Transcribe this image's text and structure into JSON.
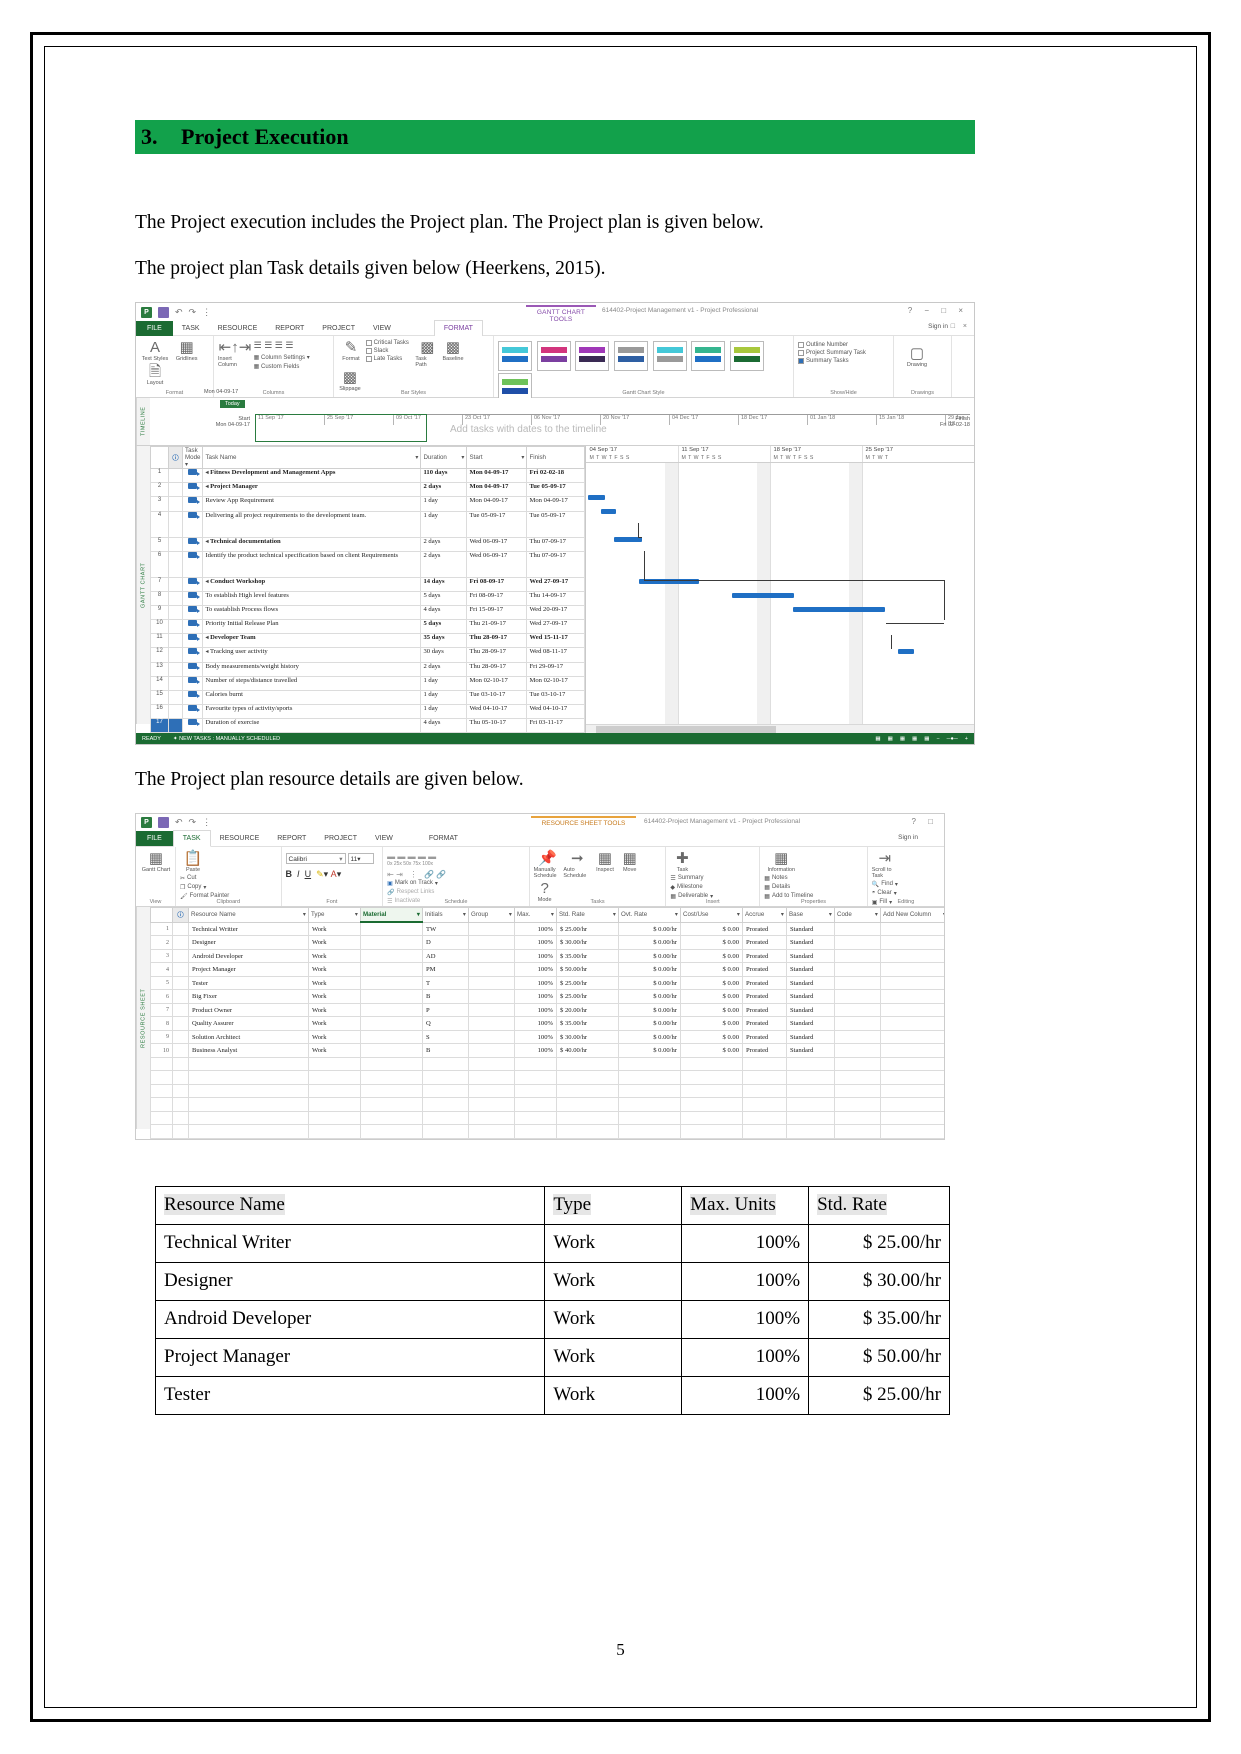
{
  "document": {
    "heading_number": "3.",
    "heading_title": "Project Execution",
    "paragraph_1": "The Project execution includes the Project plan. The Project plan is given below.",
    "paragraph_2": "The project plan Task details given below (Heerkens, 2015).",
    "paragraph_3": "The Project plan resource details are given below.",
    "page_number": "5",
    "heading_band_color": "#12A14B"
  },
  "gantt_screenshot": {
    "title_bar": {
      "app_icon": "project-icon",
      "context_tab": "GANTT CHART TOOLS",
      "document_title": "614402-Project Management v1 - Project Professional",
      "sign_in": "Sign in",
      "help": "?"
    },
    "ribbon_tabs": [
      "FILE",
      "TASK",
      "RESOURCE",
      "REPORT",
      "PROJECT",
      "VIEW",
      "FORMAT"
    ],
    "active_tab": "FORMAT",
    "ribbon_groups": [
      {
        "label": "Format",
        "buttons": [
          "Text Styles",
          "Gridlines",
          "Layout"
        ]
      },
      {
        "label": "Columns",
        "buttons": [
          "Insert Column",
          "Column Settings",
          "Custom Fields"
        ]
      },
      {
        "label": "Bar Styles",
        "checkboxes": [
          "Critical Tasks",
          "Slack",
          "Late Tasks"
        ],
        "buttons": [
          "Format",
          "Task Path",
          "Baseline",
          "Slippage"
        ]
      },
      {
        "label": "Gantt Chart Style"
      },
      {
        "label": "Show/Hide",
        "checkboxes": [
          "Outline Number",
          "Project Summary Task",
          "Summary Tasks"
        ]
      },
      {
        "label": "Drawings",
        "buttons": [
          "Drawing"
        ]
      }
    ],
    "timeline": {
      "side_label": "TIMELINE",
      "today_label": "Today",
      "today_date": "Mon 04-09-17",
      "start_label": "Start",
      "start_date": "Mon 04-09-17",
      "finish_label": "Finish",
      "finish_date": "Fri 02-02-18",
      "placeholder": "Add tasks with dates to the timeline",
      "ticks": [
        "11 Sep '17",
        "25 Sep '17",
        "09 Oct '17",
        "23 Oct '17",
        "06 Nov '17",
        "20 Nov '17",
        "04 Dec '17",
        "18 Dec '17",
        "01 Jan '18",
        "15 Jan '18",
        "29 Jan '18"
      ]
    },
    "side_label": "GANTT CHART",
    "columns": [
      "",
      "i",
      "Task Mode",
      "Task Name",
      "Duration",
      "Start",
      "Finish"
    ],
    "rows": [
      {
        "id": "1",
        "level": 0,
        "name": "Fitness Development and Management Apps",
        "duration": "110 days",
        "start": "Mon 04-09-17",
        "finish": "Fri 02-02-18",
        "bold": true
      },
      {
        "id": "2",
        "level": 1,
        "name": "Project Manager",
        "duration": "2 days",
        "start": "Mon 04-09-17",
        "finish": "Tue 05-09-17",
        "bold": true
      },
      {
        "id": "3",
        "level": 2,
        "name": "Review App Requirement",
        "duration": "1 day",
        "start": "Mon 04-09-17",
        "finish": "Mon 04-09-17",
        "bold": false
      },
      {
        "id": "4",
        "level": 2,
        "name": "Delivering all project requirements to the development team.",
        "duration": "1 day",
        "start": "Tue 05-09-17",
        "finish": "Tue 05-09-17",
        "bold": false
      },
      {
        "id": "5",
        "level": 1,
        "name": "Technical documentation",
        "duration": "2 days",
        "start": "Wed 06-09-17",
        "finish": "Thu 07-09-17",
        "bold": true
      },
      {
        "id": "6",
        "level": 2,
        "name": "Identify the product technical specification based on client Requirements",
        "duration": "2 days",
        "start": "Wed 06-09-17",
        "finish": "Thu 07-09-17",
        "bold": false
      },
      {
        "id": "7",
        "level": 1,
        "name": "Conduct Workshop",
        "duration": "14 days",
        "start": "Fri 08-09-17",
        "finish": "Wed 27-09-17",
        "bold": true
      },
      {
        "id": "8",
        "level": 2,
        "name": "To establish High level features",
        "duration": "5 days",
        "start": "Fri 08-09-17",
        "finish": "Thu 14-09-17",
        "bold": false
      },
      {
        "id": "9",
        "level": 2,
        "name": "To eastablish Process flows",
        "duration": "4 days",
        "start": "Fri 15-09-17",
        "finish": "Wed 20-09-17",
        "bold": false
      },
      {
        "id": "10",
        "level": 2,
        "name": "Priority Initial Release Plan",
        "duration": "5 days",
        "start": "Thu 21-09-17",
        "finish": "Wed 27-09-17",
        "bold": false
      },
      {
        "id": "11",
        "level": 1,
        "name": "Developer Team",
        "duration": "35 days",
        "start": "Thu 28-09-17",
        "finish": "Wed 15-11-17",
        "bold": true
      },
      {
        "id": "12",
        "level": 2,
        "name": "Tracking user activity",
        "duration": "30 days",
        "start": "Thu 28-09-17",
        "finish": "Wed 08-11-17",
        "bold": false
      },
      {
        "id": "13",
        "level": 3,
        "name": "Body measurements/weight history",
        "duration": "2 days",
        "start": "Thu 28-09-17",
        "finish": "Fri 29-09-17",
        "bold": false
      },
      {
        "id": "14",
        "level": 3,
        "name": "Number of steps/distance travelled",
        "duration": "1 day",
        "start": "Mon 02-10-17",
        "finish": "Mon 02-10-17",
        "bold": false
      },
      {
        "id": "15",
        "level": 3,
        "name": "Calories burnt",
        "duration": "1 day",
        "start": "Tue 03-10-17",
        "finish": "Tue 03-10-17",
        "bold": false
      },
      {
        "id": "16",
        "level": 3,
        "name": "Favourite types of activity/sports",
        "duration": "1 day",
        "start": "Wed 04-10-17",
        "finish": "Wed 04-10-17",
        "bold": false
      },
      {
        "id": "17",
        "level": 3,
        "name": "Duration of exercise",
        "duration": "4 days",
        "start": "Thu 05-10-17",
        "finish": "Fri 03-11-17",
        "bold": false
      }
    ],
    "chart_header": [
      {
        "label": "04 Sep '17",
        "days": "M T W T F S S"
      },
      {
        "label": "11 Sep '17",
        "days": "M T W T F S S"
      },
      {
        "label": "18 Sep '17",
        "days": "M T W T F S S"
      },
      {
        "label": "25 Sep '17",
        "days": "M T W T"
      }
    ],
    "status_bar": {
      "ready": "READY",
      "new_tasks": "NEW TASKS : MANUALLY SCHEDULED",
      "zoom": "100%"
    }
  },
  "resource_screenshot": {
    "title_bar": {
      "context_tab": "RESOURCE SHEET TOOLS",
      "document_title": "614402-Project Management v1 - Project Professional",
      "sign_in": "Sign in"
    },
    "ribbon_tabs": [
      "FILE",
      "TASK",
      "RESOURCE",
      "REPORT",
      "PROJECT",
      "VIEW",
      "FORMAT"
    ],
    "active_tab": "TASK",
    "ribbon_groups": [
      {
        "label": "View",
        "buttons": [
          "Gantt Chart"
        ]
      },
      {
        "label": "Clipboard",
        "buttons": [
          "Paste",
          "Cut",
          "Copy",
          "Format Painter"
        ]
      },
      {
        "label": "Font",
        "font_name": "Calibri",
        "font_size": "11",
        "buttons": [
          "B",
          "I",
          "U"
        ]
      },
      {
        "label": "Schedule",
        "buttons": [
          "Mark on Track",
          "Respect Links",
          "Inactivate"
        ],
        "percents": [
          "0x",
          "25x",
          "50x",
          "75x",
          "100x"
        ]
      },
      {
        "label": "Tasks",
        "buttons": [
          "Manually Schedule",
          "Auto Schedule",
          "Inspect",
          "Move",
          "Mode"
        ]
      },
      {
        "label": "Insert",
        "buttons": [
          "Task",
          "Summary",
          "Milestone",
          "Deliverable"
        ]
      },
      {
        "label": "Properties",
        "buttons": [
          "Information",
          "Notes",
          "Details",
          "Add to Timeline"
        ]
      },
      {
        "label": "Editing",
        "buttons": [
          "Scroll to Task",
          "Find",
          "Clear",
          "Fill"
        ]
      }
    ],
    "side_label": "RESOURCE SHEET",
    "columns": [
      "",
      "i",
      "Resource Name",
      "Type",
      "Material",
      "Initials",
      "Group",
      "Max.",
      "Std. Rate",
      "Ovt. Rate",
      "Cost/Use",
      "Accrue",
      "Base",
      "Code",
      "Add New Column"
    ],
    "selected_column": "Material",
    "rows": [
      {
        "id": "1",
        "name": "Technical Writter",
        "type": "Work",
        "material": "",
        "initials": "TW",
        "group": "",
        "max": "100%",
        "std_rate": "$ 25.00/hr",
        "ovt_rate": "$ 0.00/hr",
        "cost_use": "$ 0.00",
        "accrue": "Prorated",
        "base": "Standard"
      },
      {
        "id": "2",
        "name": "Designer",
        "type": "Work",
        "material": "",
        "initials": "D",
        "group": "",
        "max": "100%",
        "std_rate": "$ 30.00/hr",
        "ovt_rate": "$ 0.00/hr",
        "cost_use": "$ 0.00",
        "accrue": "Prorated",
        "base": "Standard"
      },
      {
        "id": "3",
        "name": "Android Developer",
        "type": "Work",
        "material": "",
        "initials": "AD",
        "group": "",
        "max": "100%",
        "std_rate": "$ 35.00/hr",
        "ovt_rate": "$ 0.00/hr",
        "cost_use": "$ 0.00",
        "accrue": "Prorated",
        "base": "Standard"
      },
      {
        "id": "4",
        "name": "Project Manager",
        "type": "Work",
        "material": "",
        "initials": "PM",
        "group": "",
        "max": "100%",
        "std_rate": "$ 50.00/hr",
        "ovt_rate": "$ 0.00/hr",
        "cost_use": "$ 0.00",
        "accrue": "Prorated",
        "base": "Standard"
      },
      {
        "id": "5",
        "name": "Tester",
        "type": "Work",
        "material": "",
        "initials": "T",
        "group": "",
        "max": "100%",
        "std_rate": "$ 25.00/hr",
        "ovt_rate": "$ 0.00/hr",
        "cost_use": "$ 0.00",
        "accrue": "Prorated",
        "base": "Standard"
      },
      {
        "id": "6",
        "name": "Big Fixer",
        "type": "Work",
        "material": "",
        "initials": "B",
        "group": "",
        "max": "100%",
        "std_rate": "$ 25.00/hr",
        "ovt_rate": "$ 0.00/hr",
        "cost_use": "$ 0.00",
        "accrue": "Prorated",
        "base": "Standard"
      },
      {
        "id": "7",
        "name": "Product Owner",
        "type": "Work",
        "material": "",
        "initials": "P",
        "group": "",
        "max": "100%",
        "std_rate": "$ 20.00/hr",
        "ovt_rate": "$ 0.00/hr",
        "cost_use": "$ 0.00",
        "accrue": "Prorated",
        "base": "Standard"
      },
      {
        "id": "8",
        "name": "Quality Assurer",
        "type": "Work",
        "material": "",
        "initials": "Q",
        "group": "",
        "max": "100%",
        "std_rate": "$ 35.00/hr",
        "ovt_rate": "$ 0.00/hr",
        "cost_use": "$ 0.00",
        "accrue": "Prorated",
        "base": "Standard"
      },
      {
        "id": "9",
        "name": "Solution Architect",
        "type": "Work",
        "material": "",
        "initials": "S",
        "group": "",
        "max": "100%",
        "std_rate": "$ 30.00/hr",
        "ovt_rate": "$ 0.00/hr",
        "cost_use": "$ 0.00",
        "accrue": "Prorated",
        "base": "Standard"
      },
      {
        "id": "10",
        "name": "Business Analyst",
        "type": "Work",
        "material": "",
        "initials": "B",
        "group": "",
        "max": "100%",
        "std_rate": "$ 40.00/hr",
        "ovt_rate": "$ 0.00/hr",
        "cost_use": "$ 0.00",
        "accrue": "Prorated",
        "base": "Standard"
      }
    ]
  },
  "word_table": {
    "headers": [
      "Resource Name",
      "Type",
      "Max. Units",
      "Std. Rate"
    ],
    "rows": [
      {
        "name": "Technical Writer",
        "type": "Work",
        "units": "100%",
        "rate": "$ 25.00/hr"
      },
      {
        "name": "Designer",
        "type": "Work",
        "units": "100%",
        "rate": "$ 30.00/hr"
      },
      {
        "name": "Android Developer",
        "type": "Work",
        "units": "100%",
        "rate": "$ 35.00/hr"
      },
      {
        "name": "Project Manager",
        "type": "Work",
        "units": "100%",
        "rate": "$ 50.00/hr"
      },
      {
        "name": "Tester",
        "type": "Work",
        "units": "100%",
        "rate": "$ 25.00/hr"
      }
    ]
  }
}
